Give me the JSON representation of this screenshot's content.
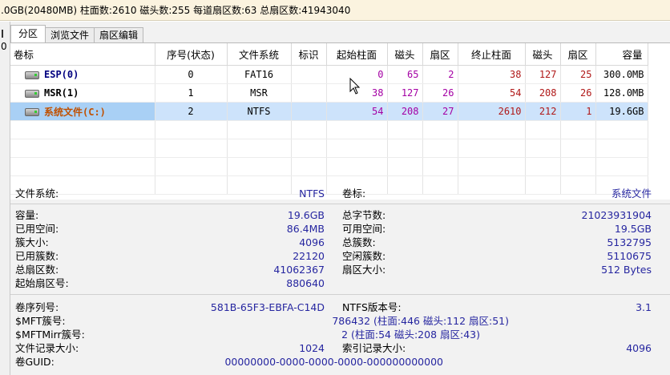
{
  "topbar": {
    "text": ".0GB(20480MB)  柱面数:2610  磁头数:255  每道扇区数:63  总扇区数:41943040"
  },
  "leftstrip": {
    "digit": "0"
  },
  "tabs": [
    "分区",
    "浏览文件",
    "扇区编辑"
  ],
  "columns": [
    "卷标",
    "序号(状态)",
    "文件系统",
    "标识",
    "起始柱面",
    "磁头",
    "扇区",
    "终止柱面",
    "磁头",
    "扇区",
    "容量"
  ],
  "partitions": [
    {
      "name": "ESP(0)",
      "index": "0",
      "fs": "FAT16",
      "id": "",
      "start_cyl": "0",
      "start_head": "65",
      "start_sec": "2",
      "end_cyl": "38",
      "end_head": "127",
      "end_sec": "25",
      "size": "300.0MB"
    },
    {
      "name": "MSR(1)",
      "index": "1",
      "fs": "MSR",
      "id": "",
      "start_cyl": "38",
      "start_head": "127",
      "start_sec": "26",
      "end_cyl": "54",
      "end_head": "208",
      "end_sec": "26",
      "size": "128.0MB"
    },
    {
      "name": "系统文件(C:)",
      "index": "2",
      "fs": "NTFS",
      "id": "",
      "start_cyl": "54",
      "start_head": "208",
      "start_sec": "27",
      "end_cyl": "2610",
      "end_head": "212",
      "end_sec": "1",
      "size": "19.6GB"
    }
  ],
  "info": {
    "fs_label": "文件系统:",
    "fs_value": "NTFS",
    "vol_label": "卷标:",
    "vol_value": "系统文件",
    "capacity_label": "容量:",
    "capacity_value": "19.6GB",
    "total_bytes_label": "总字节数:",
    "total_bytes_value": "21023931904",
    "used_label": "已用空间:",
    "used_value": "86.4MB",
    "free_label": "可用空间:",
    "free_value": "19.5GB",
    "cluster_size_label": "簇大小:",
    "cluster_size_value": "4096",
    "total_clusters_label": "总簇数:",
    "total_clusters_value": "5132795",
    "used_clusters_label": "已用簇数:",
    "used_clusters_value": "22120",
    "free_clusters_label": "空闲簇数:",
    "free_clusters_value": "5110675",
    "total_sectors_label": "总扇区数:",
    "total_sectors_value": "41062367",
    "sector_size_label": "扇区大小:",
    "sector_size_value": "512 Bytes",
    "start_sector_label": "起始扇区号:",
    "start_sector_value": "880640",
    "serial_label": "卷序列号:",
    "serial_value": "581B-65F3-EBFA-C14D",
    "ntfs_ver_label": "NTFS版本号:",
    "ntfs_ver_value": "3.1",
    "mft_label": "$MFT簇号:",
    "mft_value": "786432 (柱面:446 磁头:112 扇区:51)",
    "mftmirr_label": "$MFTMirr簇号:",
    "mftmirr_value": "2 (柱面:54 磁头:208 扇区:43)",
    "record_size_label": "文件记录大小:",
    "record_size_value": "1024",
    "index_size_label": "索引记录大小:",
    "index_size_value": "4096",
    "guid_label": "卷GUID:",
    "guid_value": "00000000-0000-0000-0000-000000000000"
  }
}
